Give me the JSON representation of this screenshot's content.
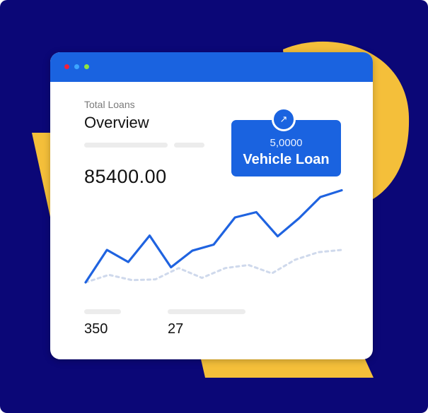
{
  "card": {
    "subtitle": "Total Loans",
    "title": "Overview",
    "total_value": "85400.00",
    "stats": [
      "350",
      "27"
    ]
  },
  "badge": {
    "amount": "5,0000",
    "label": "Vehicle Loan",
    "icon": "arrow-up-right-icon"
  },
  "colors": {
    "background": "#0b0777",
    "window_titlebar": "#1a63e0",
    "accent_yellow": "#f4bf3a",
    "line_primary": "#1f63e0",
    "line_secondary": "#cfd9ec"
  },
  "chart_data": {
    "type": "line",
    "series": [
      {
        "values": [
          0.0,
          0.43,
          0.27,
          0.62,
          0.2,
          0.42,
          0.5,
          0.86,
          0.93,
          0.61,
          0.85,
          1.13,
          1.22
        ]
      },
      {
        "values": [
          0.0,
          0.1,
          0.03,
          0.04,
          0.19,
          0.06,
          0.19,
          0.23,
          0.12,
          0.3,
          0.4,
          0.43
        ]
      }
    ],
    "grid": false,
    "axes_visible": false
  }
}
